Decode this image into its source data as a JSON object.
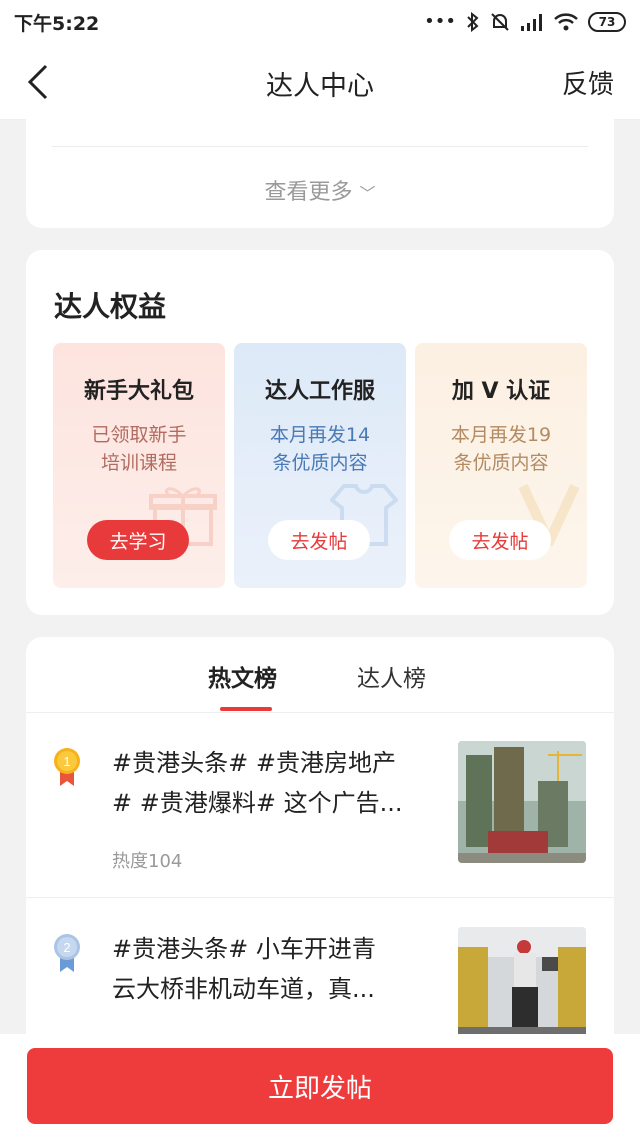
{
  "status_bar": {
    "time": "下午5:22",
    "battery": "73",
    "icons": [
      "dots-icon",
      "bluetooth-icon",
      "mute-icon",
      "signal-icon",
      "wifi-icon",
      "battery-icon"
    ]
  },
  "nav": {
    "title": "达人中心",
    "feedback": "反馈"
  },
  "more": {
    "label": "查看更多"
  },
  "benefits": {
    "title": "达人权益",
    "items": [
      {
        "name": "新手大礼包",
        "desc_line1": "已领取新手",
        "desc_line2": "培训课程",
        "button": "去学习"
      },
      {
        "name": "达人工作服",
        "desc_line1": "本月再发14",
        "desc_line2": "条优质内容",
        "button": "去发帖"
      },
      {
        "name": "加 V 认证",
        "desc_line1": "本月再发19",
        "desc_line2": "条优质内容",
        "button": "去发帖"
      }
    ]
  },
  "tabs": {
    "hot": "热文榜",
    "talent": "达人榜"
  },
  "posts": [
    {
      "rank": "1",
      "title_line1": "#贵港头条# #贵港房地产",
      "title_line2": "# #贵港爆料# 这个广告...",
      "heat": "热度104"
    },
    {
      "rank": "2",
      "title_line1": "#贵港头条# 小车开进青",
      "title_line2": "云大桥非机动车道，真..."
    }
  ],
  "bottom": {
    "publish": "立即发帖"
  },
  "colors": {
    "accent": "#ee3b3c",
    "gold": "#f5b21b",
    "silver": "#a9c4e6"
  }
}
